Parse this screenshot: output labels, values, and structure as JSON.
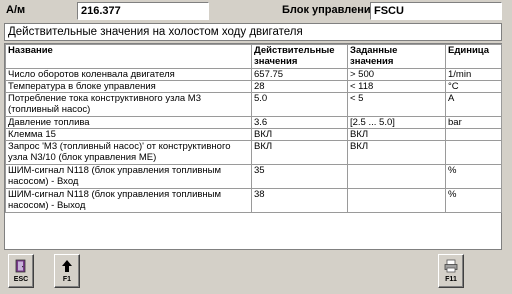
{
  "header": {
    "am_label": "A/м",
    "am_value": "216.377",
    "unit_label": "Блок управления",
    "unit_value": "FSCU"
  },
  "title": "Действительные значения на холостом ходу двигателя",
  "table": {
    "columns": [
      "Название",
      "Действительные значения",
      "Заданные значения",
      "Единица"
    ],
    "rows": [
      [
        "Число оборотов коленвала двигателя",
        "657.75",
        "> 500",
        "1/min"
      ],
      [
        "Температура в блоке управления",
        "28",
        "< 118",
        "°C"
      ],
      [
        "Потребление тока конструктивного узла M3 (топливный насос)",
        "5.0",
        "< 5",
        "A"
      ],
      [
        "Давление топлива",
        "3.6",
        "[2.5 ... 5.0]",
        "bar"
      ],
      [
        "Клемма 15",
        "ВКЛ",
        "ВКЛ",
        ""
      ],
      [
        "Запрос 'M3 (топливный насос)' от конструктивного узла N3/10 (блок управления ME)",
        "ВКЛ",
        "ВКЛ",
        ""
      ],
      [
        "ШИМ-сигнал N118 (блок управления топливным насосом) - Вход",
        "35",
        "",
        "%"
      ],
      [
        "ШИМ-сигнал N118 (блок управления топливным насосом) - Выход",
        "38",
        "",
        "%"
      ]
    ]
  },
  "buttons": {
    "esc": {
      "label": "ESC",
      "icon": "exit-door-icon"
    },
    "f1": {
      "label": "F1",
      "icon": "arrow-up-icon"
    },
    "f11": {
      "label": "F11",
      "icon": "printer-icon"
    }
  }
}
